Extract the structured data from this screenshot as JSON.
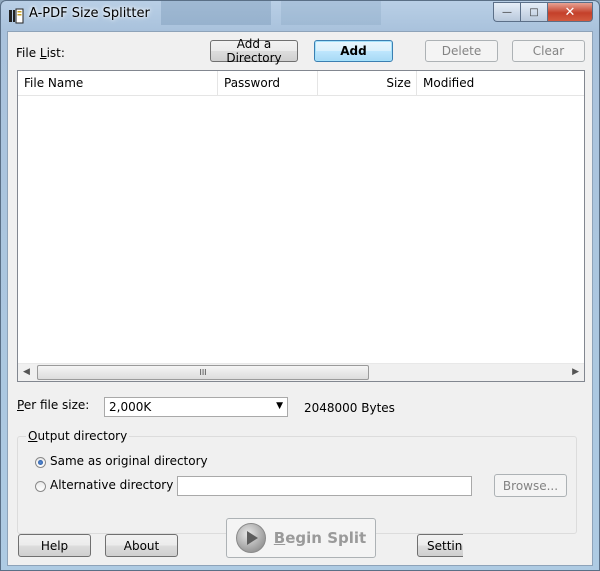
{
  "window": {
    "title": "A-PDF Size Splitter",
    "minimize_glyph": "—",
    "maximize_glyph": "□",
    "close_glyph": "✕"
  },
  "toolbar": {
    "file_list_prefix": "File ",
    "file_list_access": "L",
    "file_list_suffix": "ist:",
    "add_directory_label": "Add a Directory",
    "add_label": "Add",
    "delete_label": "Delete",
    "clear_label": "Clear"
  },
  "file_list": {
    "columns": [
      "File Name",
      "Password",
      "Size",
      "Modified"
    ],
    "rows": [],
    "scroll_grip": "III"
  },
  "per_file_size": {
    "label_access": "P",
    "label_rest": "er file size:",
    "value": "2,000K",
    "bytes_text": "2048000 Bytes"
  },
  "output": {
    "group_access": "O",
    "group_rest": "utput directory",
    "same_label": "Same as original directory",
    "alt_label": "Alternative directory",
    "alt_value": "",
    "browse_label": "Browse..."
  },
  "footer": {
    "help_label": "Help",
    "about_label": "About",
    "begin_split_access": "B",
    "begin_split_rest": "egin Split",
    "settings_label": "Setting"
  },
  "colors": {
    "default_button_border": "#3c7fb1",
    "close_button": "#c4402a",
    "disabled_text": "#838383"
  }
}
